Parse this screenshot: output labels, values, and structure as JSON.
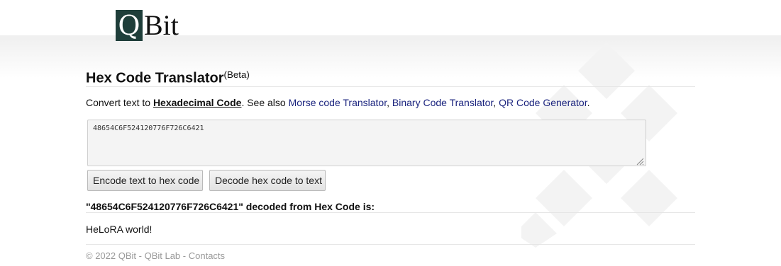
{
  "logo": {
    "q_letter": "Q",
    "rest": "Bit",
    "brand_color": "#1f3e3a"
  },
  "header": {
    "title": "Hex Code Translator",
    "badge": "(Beta)"
  },
  "intro": {
    "prefix": "Convert text to ",
    "main_link": "Hexadecimal Code",
    "middle": ". See also ",
    "links": [
      "Morse code Translator",
      "Binary Code Translator",
      "QR Code Generator"
    ],
    "separator": ", ",
    "suffix": ".",
    "link_color": "#1a237e"
  },
  "input": {
    "value": "48654C6F524120776F726C6421"
  },
  "buttons": {
    "encode_label": "Encode text to hex code",
    "decode_label": "Decode hex code to text"
  },
  "result": {
    "title": "\"48654C6F524120776F726C6421\" decoded from Hex Code is:",
    "text": "HeLoRA world!"
  },
  "footer": {
    "copyright": "© 2022 QBit",
    "sep": " - ",
    "lab": "QBit Lab",
    "contacts": "Contacts"
  }
}
